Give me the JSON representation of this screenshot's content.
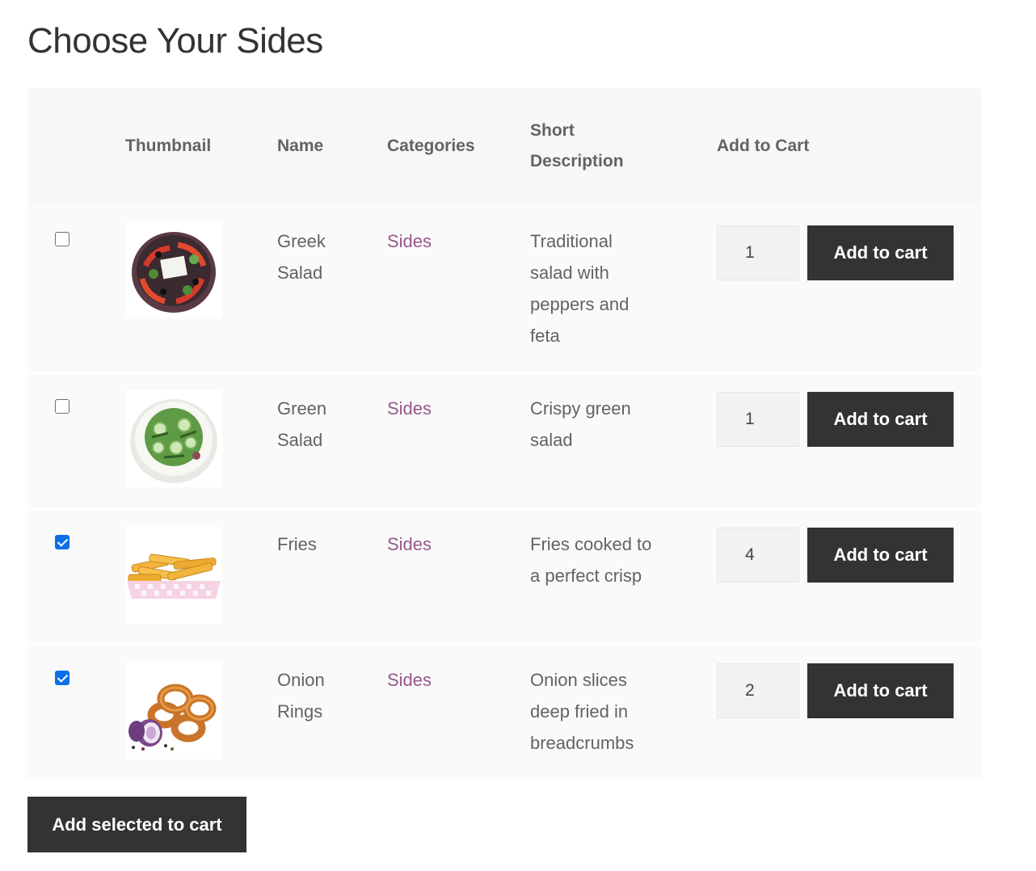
{
  "page": {
    "title": "Choose Your Sides"
  },
  "table": {
    "headers": {
      "thumbnail": "Thumbnail",
      "name": "Name",
      "categories": "Categories",
      "short_description_line1": "Short",
      "short_description_line2": "Description",
      "add_to_cart": "Add to Cart"
    },
    "rows": [
      {
        "checked": false,
        "thumbnail_icon": "greek-salad-image",
        "name_line1": "Greek",
        "name_line2": "Salad",
        "category": "Sides",
        "desc_lines": [
          "Traditional",
          "salad with",
          "peppers and",
          "feta"
        ],
        "quantity": "1",
        "button_label": "Add to cart"
      },
      {
        "checked": false,
        "thumbnail_icon": "green-salad-image",
        "name_line1": "Green",
        "name_line2": "Salad",
        "category": "Sides",
        "desc_lines": [
          "Crispy green",
          "salad"
        ],
        "quantity": "1",
        "button_label": "Add to cart"
      },
      {
        "checked": true,
        "thumbnail_icon": "fries-image",
        "name_line1": "Fries",
        "name_line2": "",
        "category": "Sides",
        "desc_lines": [
          "Fries cooked to",
          "a perfect crisp"
        ],
        "quantity": "4",
        "button_label": "Add to cart"
      },
      {
        "checked": true,
        "thumbnail_icon": "onion-rings-image",
        "name_line1": "Onion",
        "name_line2": "Rings",
        "category": "Sides",
        "desc_lines": [
          "Onion slices",
          "deep fried in",
          "breadcrumbs"
        ],
        "quantity": "2",
        "button_label": "Add to cart"
      }
    ]
  },
  "bulk_button": {
    "label": "Add selected to cart"
  },
  "colors": {
    "button_bg": "#333333",
    "header_bg": "#f7f7f7",
    "row_bg": "#fafafa",
    "category_link": "#96588a",
    "checkbox_checked": "#0b6fe8"
  }
}
